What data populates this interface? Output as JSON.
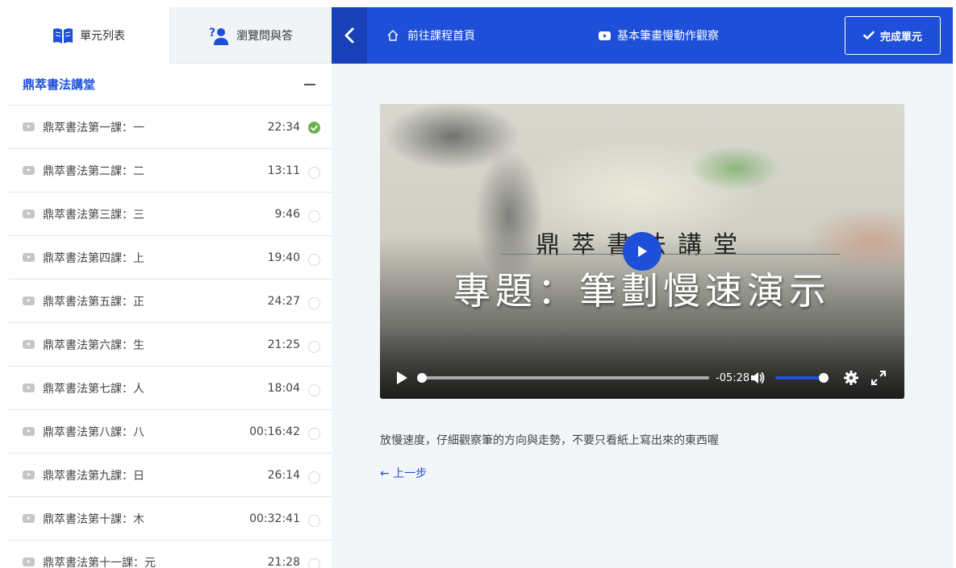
{
  "sidebar": {
    "tabs": [
      {
        "label": "單元列表",
        "icon": "book-open-icon"
      },
      {
        "label": "瀏覽問與答",
        "icon": "question-person-icon"
      }
    ],
    "section_title": "鼎萃書法講堂",
    "lessons": [
      {
        "title": "鼎萃書法第一課：一",
        "duration": "22:34",
        "completed": true
      },
      {
        "title": "鼎萃書法第二課：二",
        "duration": "13:11",
        "completed": false
      },
      {
        "title": "鼎萃書法第三課：三",
        "duration": "9:46",
        "completed": false
      },
      {
        "title": "鼎萃書法第四課：上",
        "duration": "19:40",
        "completed": false
      },
      {
        "title": "鼎萃書法第五課：正",
        "duration": "24:27",
        "completed": false
      },
      {
        "title": "鼎萃書法第六課：生",
        "duration": "21:25",
        "completed": false
      },
      {
        "title": "鼎萃書法第七課：人",
        "duration": "18:04",
        "completed": false
      },
      {
        "title": "鼎萃書法第八課：八",
        "duration": "00:16:42",
        "completed": false
      },
      {
        "title": "鼎萃書法第九課：日",
        "duration": "26:14",
        "completed": false
      },
      {
        "title": "鼎萃書法第十課：木",
        "duration": "00:32:41",
        "completed": false
      },
      {
        "title": "鼎萃書法第十一課：元",
        "duration": "21:28",
        "completed": false
      }
    ]
  },
  "topbar": {
    "home_label": "前往課程首頁",
    "video_label": "基本筆畫慢動作觀察",
    "complete_label": "完成單元"
  },
  "video": {
    "subtitle": "鼎萃書法講堂",
    "title": "專題：筆劃慢速演示",
    "remaining_time": "-05:28",
    "progress": 0,
    "volume": 1.0
  },
  "main": {
    "description": "放慢速度，仔細觀察筆的方向與走勢，不要只看紙上寫出來的東西喔",
    "prev_label": "← 上一步"
  },
  "colors": {
    "primary": "#1d4fd8",
    "done_green": "#6ab04c"
  }
}
